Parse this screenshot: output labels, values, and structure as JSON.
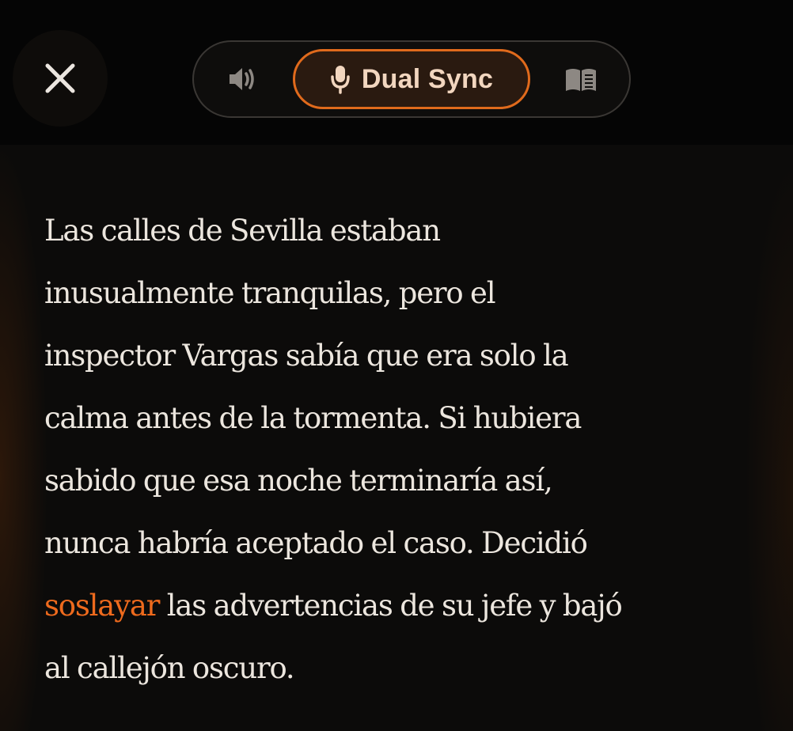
{
  "header": {
    "close": {
      "icon": "close-icon"
    },
    "modes": [
      {
        "id": "audio",
        "icon": "speaker-icon",
        "label": ""
      },
      {
        "id": "dual",
        "icon": "microphone-icon",
        "label": "Dual Sync",
        "active": true
      },
      {
        "id": "read",
        "icon": "open-book-icon",
        "label": ""
      }
    ]
  },
  "story": {
    "lines": [
      "Las calles de Sevilla estaban",
      "inusualmente tranquilas, pero el",
      "inspector Vargas sabía que era solo la",
      "calma antes de la tormenta. Si hubiera",
      "sabido que esa noche terminaría así,",
      "nunca habría aceptado el caso. Decidió"
    ],
    "highlighted_word": "soslayar",
    "line7_rest": " las advertencias de su jefe y bajó",
    "line8": "al callejón oscuro."
  },
  "colors": {
    "accent": "#e06a1c",
    "highlight_text": "#ee6a1d",
    "body_text": "#ece6de",
    "background": "#0b0a09"
  }
}
